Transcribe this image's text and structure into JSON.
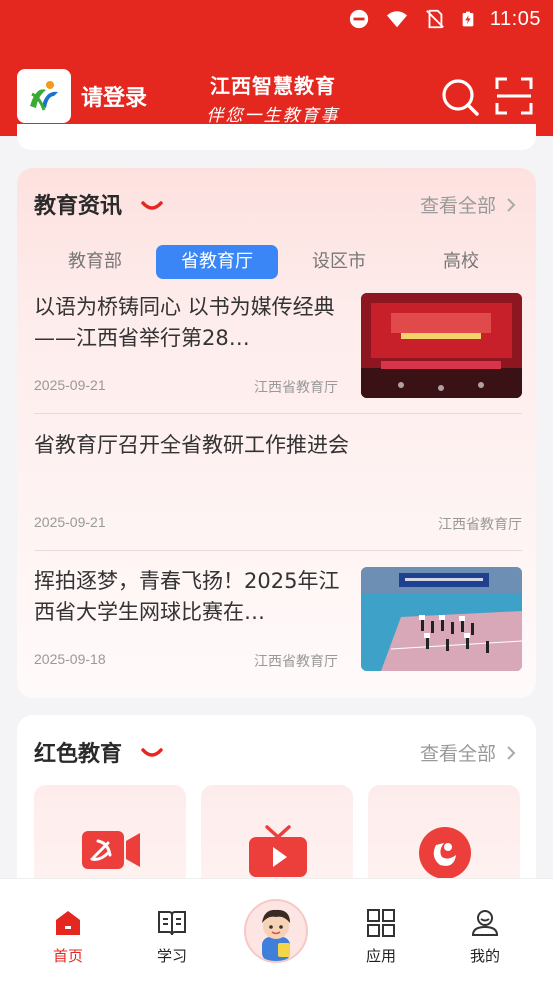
{
  "status_bar": {
    "time": "11:05"
  },
  "header": {
    "login_label": "请登录",
    "brand_title": "江西智慧教育",
    "brand_slogan": "伴您一生教育事"
  },
  "news_section": {
    "title": "教育资讯",
    "view_all": "查看全部",
    "tabs": [
      {
        "label": "教育部",
        "active": false
      },
      {
        "label": "省教育厅",
        "active": true
      },
      {
        "label": "设区市",
        "active": false
      },
      {
        "label": "高校",
        "active": false
      }
    ],
    "items": [
      {
        "title": "以语为桥铸同心 以书为媒传经典——江西省举行第28…",
        "date": "2025-09-21",
        "source": "江西省教育厅",
        "has_image": true
      },
      {
        "title": "省教育厅召开全省教研工作推进会",
        "date": "2025-09-21",
        "source": "江西省教育厅",
        "has_image": false
      },
      {
        "title": "挥拍逐梦，青春飞扬！2025年江西省大学生网球比赛在…",
        "date": "2025-09-18",
        "source": "江西省教育厅",
        "has_image": true
      }
    ]
  },
  "red_section": {
    "title": "红色教育",
    "view_all": "查看全部",
    "tiles": [
      {
        "icon": "red-video-camera-icon"
      },
      {
        "icon": "red-tv-icon"
      },
      {
        "icon": "red-record-icon"
      }
    ]
  },
  "bottom_nav": {
    "items": [
      {
        "label": "首页",
        "icon": "home-icon",
        "active": true
      },
      {
        "label": "学习",
        "icon": "book-icon",
        "active": false
      },
      {
        "label": "",
        "icon": "assistant-avatar-icon",
        "active": false
      },
      {
        "label": "应用",
        "icon": "apps-grid-icon",
        "active": false
      },
      {
        "label": "我的",
        "icon": "profile-icon",
        "active": false
      }
    ]
  },
  "colors": {
    "brand_red": "#e5281f",
    "tab_active_blue": "#3b86f7",
    "muted_text": "#999999"
  }
}
